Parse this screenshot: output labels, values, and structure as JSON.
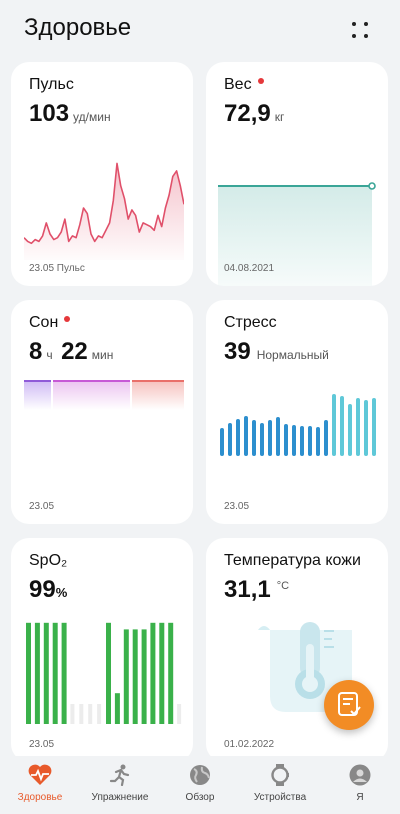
{
  "header": {
    "title": "Здоровье",
    "menu_icon": "more-icon"
  },
  "cards": {
    "pulse": {
      "title": "Пульс",
      "value": "103",
      "unit": "уд/мин",
      "footer": "23.05 Пульс",
      "color": "#e0506a"
    },
    "weight": {
      "title": "Вес",
      "value": "72,9",
      "unit": "кг",
      "footer": "04.08.2021",
      "color": "#3aa597"
    },
    "sleep": {
      "title": "Сон",
      "hours": "8",
      "hours_unit": "ч",
      "minutes": "22",
      "minutes_unit": "мин",
      "footer": "23.05"
    },
    "stress": {
      "title": "Стресс",
      "value": "39",
      "status": "Нормальный",
      "footer": "23.05"
    },
    "spo2": {
      "title": "SpO₂",
      "value": "99",
      "unit": "%",
      "footer": "23.05",
      "color": "#3ab14a"
    },
    "temperature": {
      "title": "Температура кожи",
      "value": "31,1",
      "unit": "°C",
      "footer": "01.02.2022"
    }
  },
  "chart_data": [
    {
      "type": "line",
      "name": "pulse",
      "values": [
        72,
        70,
        69,
        71,
        70,
        73,
        80,
        74,
        71,
        72,
        75,
        82,
        70,
        73,
        72,
        79,
        88,
        85,
        74,
        70,
        73,
        72,
        76,
        80,
        92,
        112,
        100,
        93,
        82,
        87,
        84,
        75,
        80,
        79,
        78,
        76,
        84,
        78,
        88,
        95,
        105,
        108,
        100,
        90
      ],
      "ylim": [
        60,
        130
      ]
    },
    {
      "type": "line",
      "name": "weight",
      "values": [
        72.9,
        72.9
      ]
    },
    {
      "type": "bar",
      "name": "stress",
      "values": [
        28,
        33,
        37,
        40,
        36,
        33,
        36,
        39,
        32,
        31,
        30,
        30,
        29,
        36,
        62,
        60,
        52,
        58,
        56,
        58
      ],
      "colors": [
        "#2d8fce",
        "#2d8fce",
        "#2d8fce",
        "#2d8fce",
        "#2d8fce",
        "#2d8fce",
        "#2d8fce",
        "#2d8fce",
        "#2d8fce",
        "#2d8fce",
        "#2d8fce",
        "#2d8fce",
        "#2d8fce",
        "#2d8fce",
        "#5fc8d8",
        "#5fc8d8",
        "#5fc8d8",
        "#5fc8d8",
        "#5fc8d8",
        "#5fc8d8"
      ],
      "ylim": [
        0,
        100
      ]
    },
    {
      "type": "bar",
      "name": "spo2",
      "values": [
        92,
        92,
        92,
        92,
        92,
        0,
        0,
        0,
        0,
        92,
        28,
        86,
        86,
        86,
        92,
        92,
        92,
        0
      ],
      "ylim": [
        0,
        100
      ]
    }
  ],
  "nav": [
    {
      "label": "Здоровье",
      "icon": "heart-pulse-icon",
      "active": true,
      "color": "#e85a2b"
    },
    {
      "label": "Упражнение",
      "icon": "running-icon",
      "active": false
    },
    {
      "label": "Обзор",
      "icon": "globe-icon",
      "active": false
    },
    {
      "label": "Устройства",
      "icon": "watch-icon",
      "active": false
    },
    {
      "label": "Я",
      "icon": "profile-icon",
      "active": false
    }
  ]
}
